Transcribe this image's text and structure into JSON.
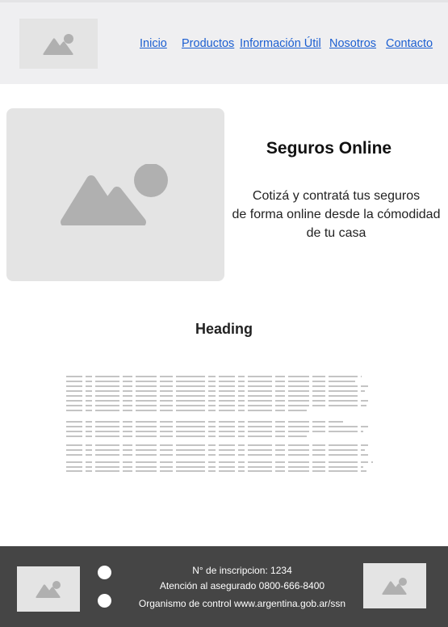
{
  "header": {
    "logo_icon": "image-placeholder-icon",
    "nav": [
      {
        "label": "Inicio"
      },
      {
        "label": "Productos"
      },
      {
        "label": "Información Útil"
      },
      {
        "label": "Nosotros"
      },
      {
        "label": "Contacto"
      }
    ]
  },
  "hero": {
    "image_icon": "image-placeholder-icon",
    "title": "Seguros Online",
    "text_line1": "Cotizá y contratá tus seguros",
    "text_line2": "de forma online desde la cómodidad",
    "text_line3": "de tu casa"
  },
  "content": {
    "heading": "Heading",
    "placeholder_text": "lorem-ipsum-squiggle-lines"
  },
  "footer": {
    "logo_icon": "image-placeholder-icon",
    "social_icons": [
      "circle-icon",
      "circle-icon"
    ],
    "registration": "N° de inscripcion: 1234",
    "support": "Atención al asegurado 0800-666-8400",
    "control": "Organismo de control www.argentina.gob.ar/ssn"
  },
  "colors": {
    "header_bg": "#efeff1",
    "link": "#1c5fd1",
    "placeholder": "#e4e4e4",
    "placeholder_icon": "#b0b0b0",
    "footer_bg": "#454545"
  }
}
